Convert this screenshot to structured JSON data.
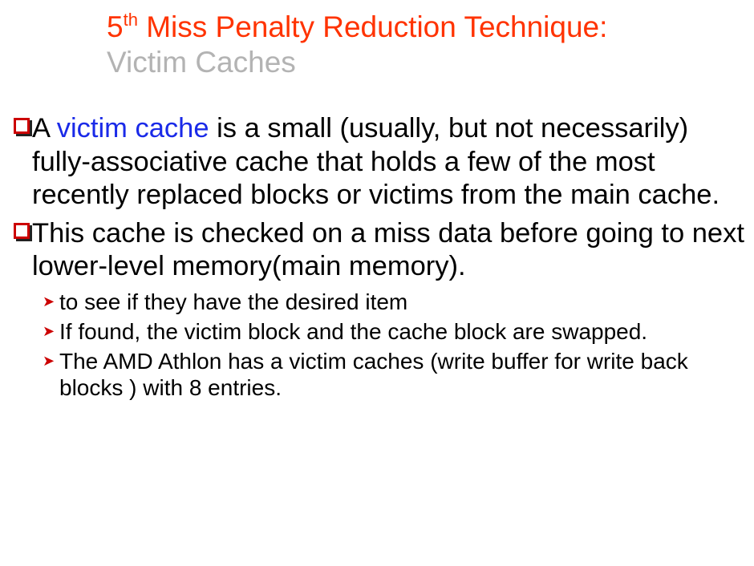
{
  "title": {
    "line1_prefix": "5",
    "line1_sup": "th",
    "line1_rest": " Miss Penalty Reduction Technique:",
    "line2": "Victim Caches"
  },
  "bullets": [
    {
      "pre": "A ",
      "highlight": "victim cache",
      "post": " is a small (usually, but not necessarily) fully-associative cache that holds a few of the most recently replaced blocks or victims from the main cache."
    },
    {
      "pre": "This cache is checked on a miss data before going to next lower-level memory(main memory).",
      "highlight": "",
      "post": ""
    }
  ],
  "subbullets": [
    "to see if they have the desired item",
    "If found, the victim block and the cache block are swapped.",
    "The AMD Athlon has a victim caches (write buffer for write back blocks ) with 8 entries."
  ],
  "colors": {
    "title": "#ff3300",
    "subtitle": "#b3b3b3",
    "highlight": "#1a2ae8",
    "bullet_box": "#cc0000"
  }
}
